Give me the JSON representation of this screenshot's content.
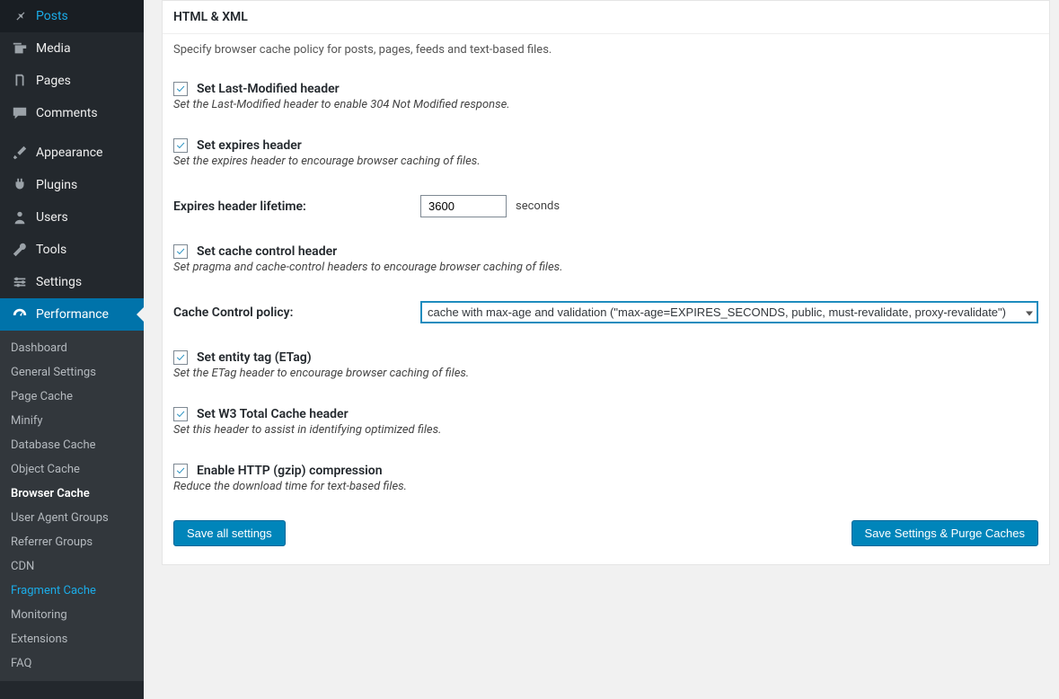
{
  "sidebar": {
    "items": [
      {
        "label": "Posts",
        "icon": "pin"
      },
      {
        "label": "Media",
        "icon": "media"
      },
      {
        "label": "Pages",
        "icon": "pages"
      },
      {
        "label": "Comments",
        "icon": "comment"
      },
      {
        "label": "Appearance",
        "icon": "brush"
      },
      {
        "label": "Plugins",
        "icon": "plug"
      },
      {
        "label": "Users",
        "icon": "user"
      },
      {
        "label": "Tools",
        "icon": "wrench"
      },
      {
        "label": "Settings",
        "icon": "sliders"
      },
      {
        "label": "Performance",
        "icon": "gauge"
      }
    ],
    "sub": [
      "Dashboard",
      "General Settings",
      "Page Cache",
      "Minify",
      "Database Cache",
      "Object Cache",
      "Browser Cache",
      "User Agent Groups",
      "Referrer Groups",
      "CDN",
      "Fragment Cache",
      "Monitoring",
      "Extensions",
      "FAQ"
    ]
  },
  "panel": {
    "title": "HTML & XML",
    "desc": "Specify browser cache policy for posts, pages, feeds and text-based files."
  },
  "settings": {
    "last_modified": {
      "label": "Set Last-Modified header",
      "help": "Set the Last-Modified header to enable 304 Not Modified response."
    },
    "expires_header": {
      "label": "Set expires header",
      "help": "Set the expires header to encourage browser caching of files."
    },
    "expires_lifetime": {
      "label": "Expires header lifetime:",
      "value": "3600",
      "suffix": "seconds"
    },
    "cache_control_header": {
      "label": "Set cache control header",
      "help": "Set pragma and cache-control headers to encourage browser caching of files."
    },
    "cache_control_policy": {
      "label": "Cache Control policy:",
      "value": "cache with max-age and validation (\"max-age=EXPIRES_SECONDS, public, must-revalidate, proxy-revalidate\")"
    },
    "etag": {
      "label": "Set entity tag (ETag)",
      "help": "Set the ETag header to encourage browser caching of files."
    },
    "w3tc_header": {
      "label": "Set W3 Total Cache header",
      "help": "Set this header to assist in identifying optimized files."
    },
    "gzip": {
      "label": "Enable HTTP (gzip) compression",
      "help": "Reduce the download time for text-based files."
    }
  },
  "buttons": {
    "save_all": "Save all settings",
    "save_purge": "Save Settings & Purge Caches"
  }
}
